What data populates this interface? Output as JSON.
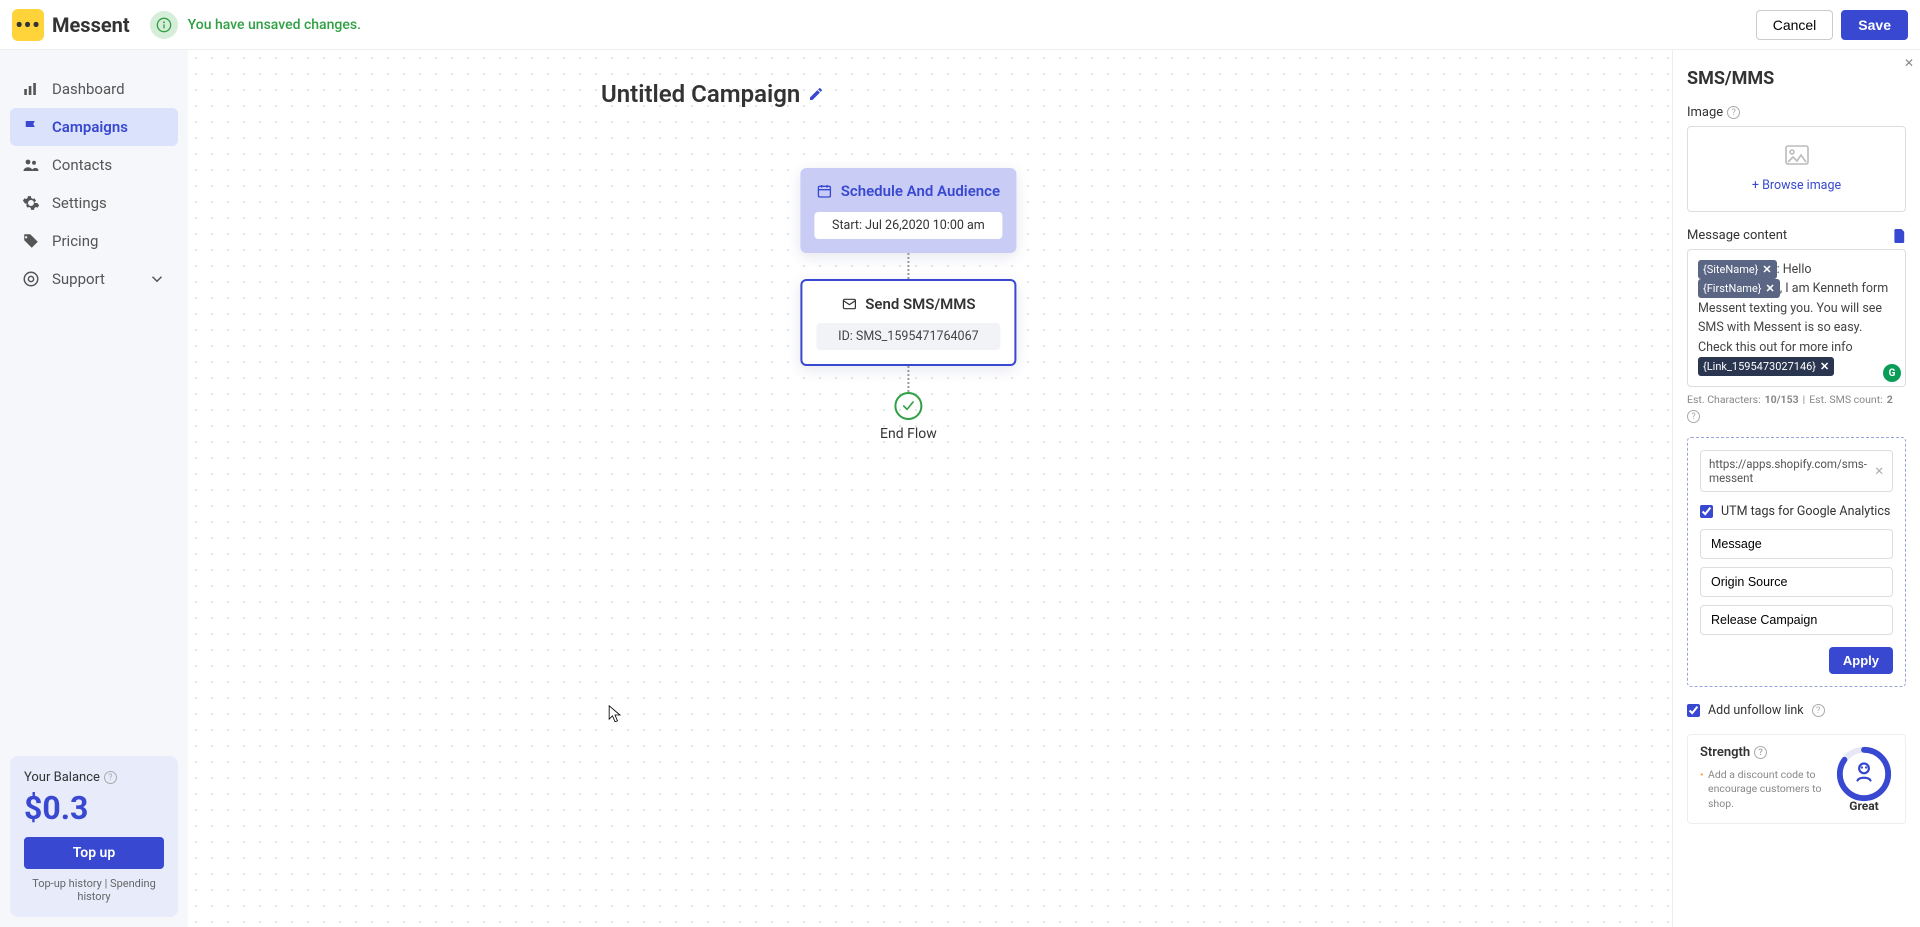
{
  "brand": "Messent",
  "alert": {
    "text": "You have unsaved changes."
  },
  "topbar": {
    "cancel": "Cancel",
    "save": "Save"
  },
  "nav": {
    "items": [
      {
        "label": "Dashboard",
        "id": "dashboard"
      },
      {
        "label": "Campaigns",
        "id": "campaigns",
        "active": true
      },
      {
        "label": "Contacts",
        "id": "contacts"
      },
      {
        "label": "Settings",
        "id": "settings"
      },
      {
        "label": "Pricing",
        "id": "pricing"
      },
      {
        "label": "Support",
        "id": "support",
        "expandable": true
      }
    ]
  },
  "balance": {
    "label": "Your Balance",
    "amount": "$0.3",
    "topup": "Top up",
    "link1": "Top-up history",
    "link2": "Spending history"
  },
  "canvas": {
    "title": "Untitled Campaign",
    "schedule": {
      "head": "Schedule And Audience",
      "body": "Start: Jul 26,2020 10:00 am"
    },
    "sms": {
      "head": "Send SMS/MMS",
      "body": "ID: SMS_1595471764067"
    },
    "end": "End Flow"
  },
  "panel": {
    "title": "SMS/MMS",
    "image_label": "Image",
    "browse": "Browse image",
    "msg_label": "Message content",
    "msg": {
      "chip1": "{SiteName}",
      "text1": ": Hello ",
      "chip2": "{FirstName}",
      "text2": ", I am Kenneth form Messent texting you. You will see SMS with Messent is so easy. Check this out for more info",
      "chip3": "{Link_1595473027146}"
    },
    "est_chars_label": "Est. Characters:",
    "est_chars": "10/153",
    "est_sms_label": "Est. SMS count:",
    "est_sms": "2",
    "link_url": "https://apps.shopify.com/sms-messent",
    "utm_label": "UTM tags for Google Analytics",
    "utm_inputs": [
      "Message",
      "Origin Source",
      "Release Campaign"
    ],
    "apply": "Apply",
    "unfollow": "Add unfollow link",
    "strength_label": "Strength",
    "strength_tip": "Add a discount code to encourage customers to shop.",
    "strength_value": "Great"
  }
}
